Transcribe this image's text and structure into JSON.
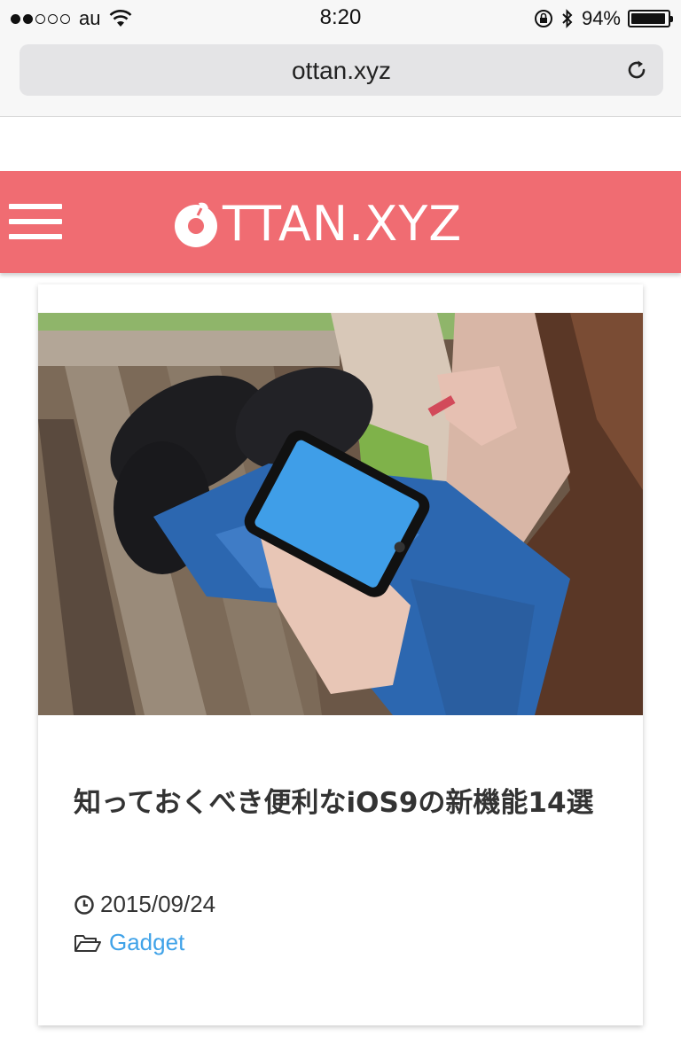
{
  "status_bar": {
    "carrier": "au",
    "time": "8:20",
    "battery_percent": "94%",
    "battery_level": 0.94,
    "signal_bars_filled": 2,
    "signal_bars_total": 5
  },
  "browser": {
    "url": "ottan.xyz"
  },
  "header": {
    "logo_text": "TTAN.XYZ",
    "color": "#f06c72"
  },
  "post": {
    "title": "知っておくべき便利なiOS9の新機能14選",
    "date": "2015/09/24",
    "category": "Gadget",
    "category_color": "#3fa2e8"
  }
}
